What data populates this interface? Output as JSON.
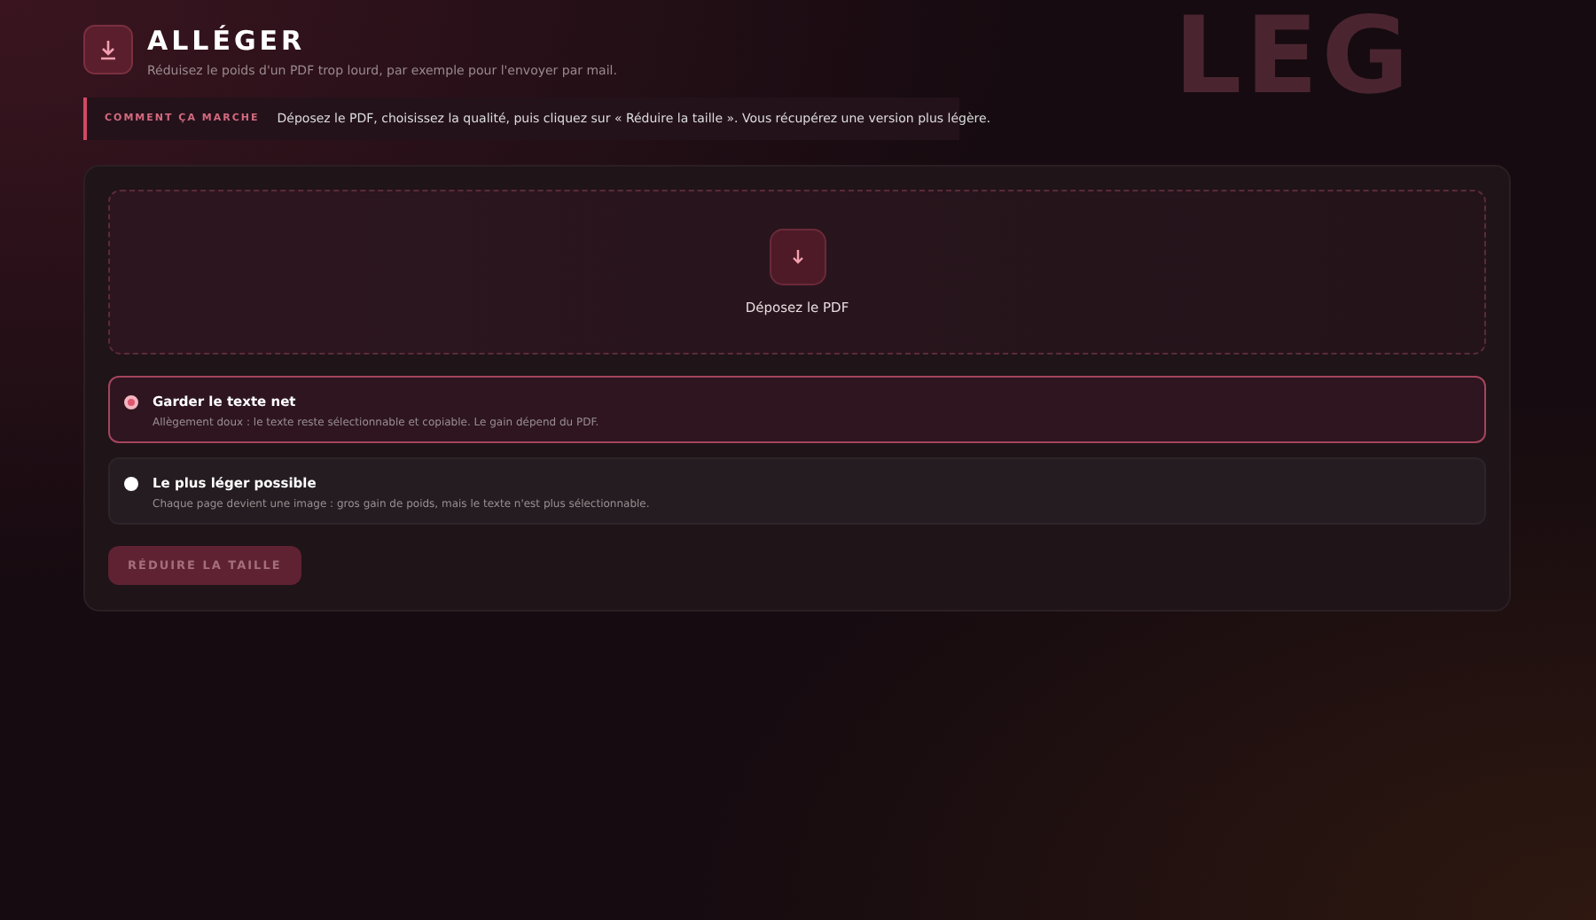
{
  "background_word": "LEG",
  "header": {
    "title": "ALLÉGER",
    "subtitle": "Réduisez le poids d'un PDF trop lourd, par exemple pour l'envoyer par mail."
  },
  "info": {
    "label": "COMMENT ÇA MARCHE",
    "text": "Déposez le PDF, choisissez la qualité, puis cliquez sur « Réduire la taille ». Vous récupérez une version plus légère."
  },
  "dropzone": {
    "label": "Déposez le PDF"
  },
  "options": [
    {
      "title": "Garder le texte net",
      "description": "Allègement doux : le texte reste sélectionnable et copiable. Le gain dépend du PDF.",
      "selected": true
    },
    {
      "title": "Le plus léger possible",
      "description": "Chaque page devient une image : gros gain de poids, mais le texte n'est plus sélectionnable.",
      "selected": false
    }
  ],
  "submit": {
    "label": "RÉDUIRE LA TAILLE",
    "disabled": true
  }
}
